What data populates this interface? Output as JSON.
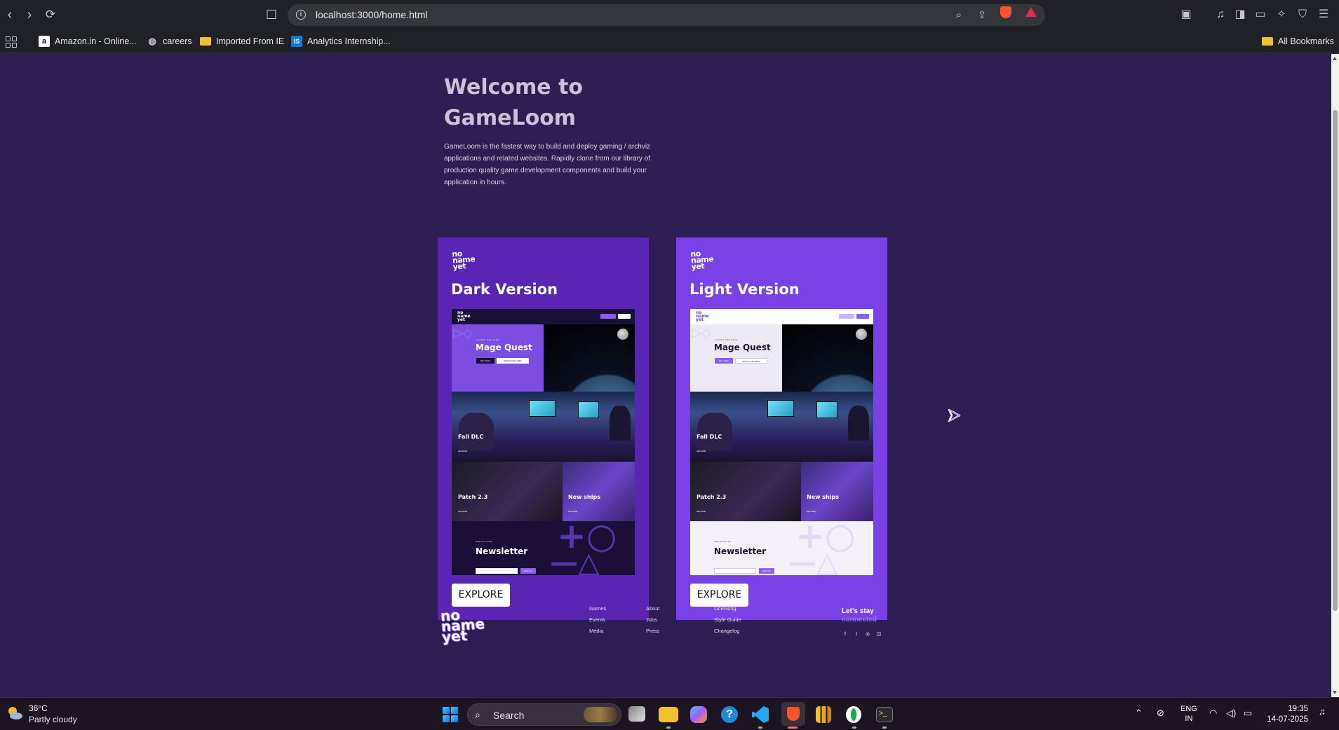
{
  "browser": {
    "url": "localhost:3000/home.html",
    "bookmarks": [
      {
        "label": "Amazon.in - Online...",
        "icon": "amazon-icon"
      },
      {
        "label": "careers",
        "icon": "globe-icon"
      },
      {
        "label": "Imported From IE",
        "icon": "folder-icon"
      },
      {
        "label": "Analytics Internship...",
        "icon": "internshala-icon"
      }
    ],
    "all_bookmarks": "All Bookmarks"
  },
  "hero": {
    "title": "Welcome to GameLoom",
    "description": "GameLoom is the fastest way to build and deploy gaming / archviz applications and related websites. Rapidly clone from our library of production quality game development components and build your application in hours."
  },
  "cards": [
    {
      "logo": "no name yet",
      "title": "Dark Version",
      "button": "EXPLORE",
      "preview": {
        "kicker": "LATEST RELEASE",
        "headline": "Mage Quest",
        "buy": "BUY NOW",
        "watch": "WATCH THE VIDEO",
        "dlc": "Fall DLC",
        "patch": "Patch 2.3",
        "ships": "New ships",
        "more": "SEE MORE",
        "news_kicker": "SIGN UP TO THE",
        "news_title": "Newsletter",
        "signup": "SIGN UP"
      }
    },
    {
      "logo": "no name yet",
      "title": "Light Version",
      "button": "EXPLORE",
      "preview": {
        "kicker": "LATEST RELEASE",
        "headline": "Mage Quest",
        "buy": "BUY NOW",
        "watch": "WATCH THE VIDEO",
        "dlc": "Fall DLC",
        "patch": "Patch 2.3",
        "ships": "New ships",
        "more": "SEE MORE",
        "news_kicker": "SIGN UP TO THE",
        "news_title": "Newsletter",
        "signup": "SIGN UP"
      }
    }
  ],
  "footer": {
    "logo": "no name yet",
    "col1": [
      "Games",
      "Events",
      "Media"
    ],
    "col2": [
      "About",
      "Jobs",
      "Press"
    ],
    "col3": [
      "Licensing",
      "Style Guide",
      "Changelog"
    ],
    "stay": "Let's stay",
    "connected": "connected"
  },
  "taskbar": {
    "temperature": "36°C",
    "weather": "Partly cloudy",
    "search": "Search",
    "lang1": "ENG",
    "lang2": "IN",
    "time": "19:35",
    "date": "14-07-2025"
  },
  "colors": {
    "page_bg": "#2d1d52",
    "dark_card": "#5b25b3",
    "light_card": "#7a41e6",
    "accent": "#9b6cf5"
  }
}
